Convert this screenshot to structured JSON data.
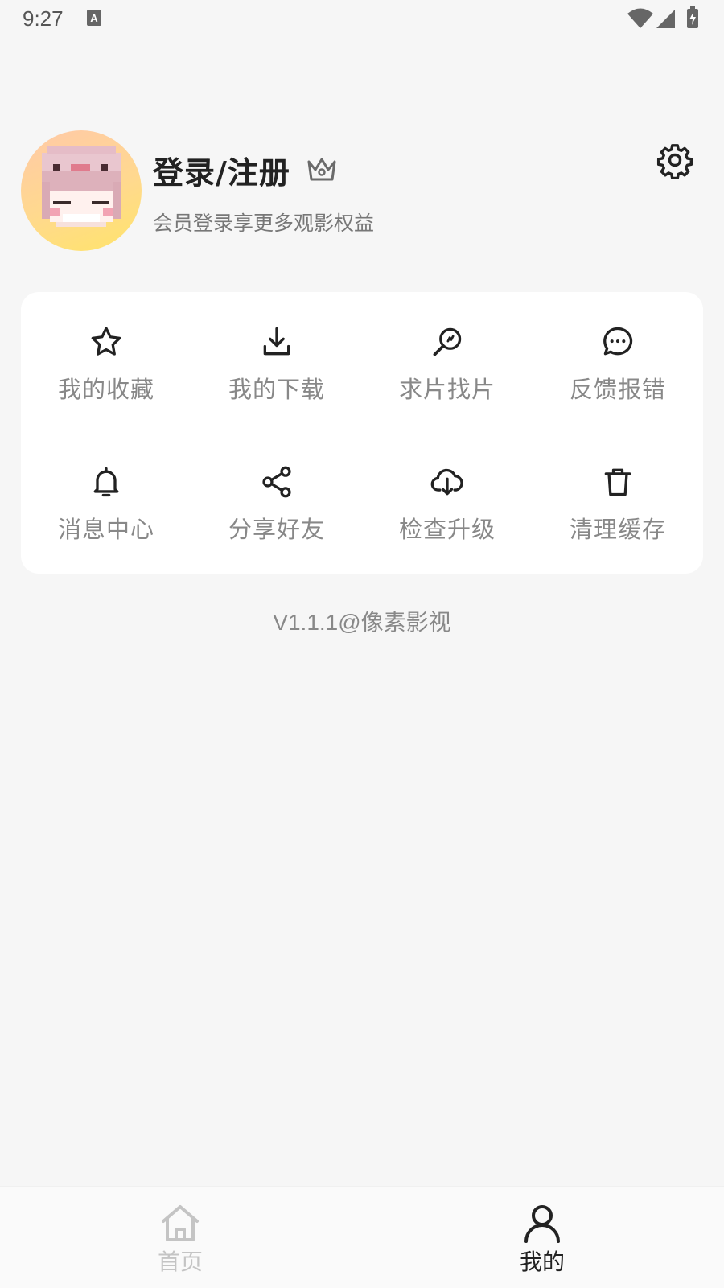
{
  "status_bar": {
    "time": "9:27",
    "keyboard_icon": "a-keyboard-icon",
    "wifi_icon": "wifi-icon",
    "signal_icon": "signal-icon",
    "battery_icon": "battery-charging-icon"
  },
  "profile": {
    "title": "登录/注册",
    "subtitle": "会员登录享更多观影权益",
    "crown_icon": "crown-icon",
    "settings_icon": "gear-icon"
  },
  "menu": {
    "items": [
      {
        "label": "我的收藏",
        "icon": "star-icon"
      },
      {
        "label": "我的下载",
        "icon": "download-icon"
      },
      {
        "label": "求片找片",
        "icon": "magnifier-icon"
      },
      {
        "label": "反馈报错",
        "icon": "chat-bubble-icon"
      },
      {
        "label": "消息中心",
        "icon": "bell-icon"
      },
      {
        "label": "分享好友",
        "icon": "share-icon"
      },
      {
        "label": "检查升级",
        "icon": "cloud-download-icon"
      },
      {
        "label": "清理缓存",
        "icon": "trash-icon"
      }
    ]
  },
  "version": "V1.1.1@像素影视",
  "bottom_nav": {
    "items": [
      {
        "label": "首页",
        "icon": "home-icon",
        "active": false
      },
      {
        "label": "我的",
        "icon": "user-icon",
        "active": true
      }
    ]
  },
  "colors": {
    "background": "#f6f6f6",
    "card": "#ffffff",
    "text_primary": "#222222",
    "text_secondary": "#888888",
    "nav_inactive": "#c4c4c4"
  }
}
